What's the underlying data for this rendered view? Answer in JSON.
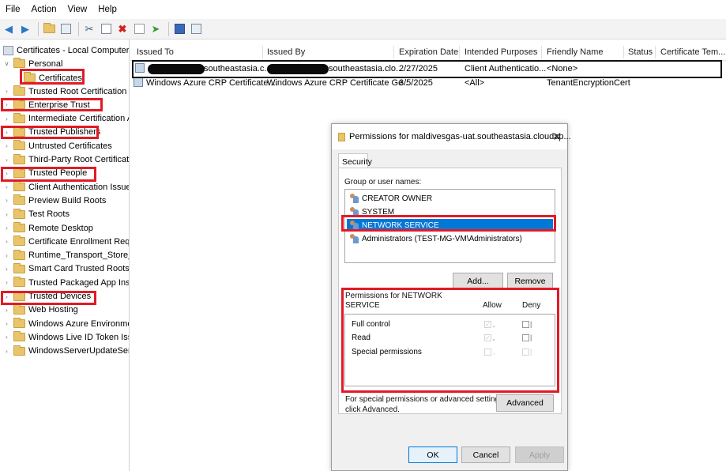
{
  "menu": [
    "File",
    "Action",
    "View",
    "Help"
  ],
  "toolbar_icons": [
    "back-arrow-icon",
    "forward-arrow-icon",
    "up-folder-icon",
    "show-hide-tree-icon",
    "cut-icon",
    "copy-icon",
    "delete-icon",
    "properties-icon",
    "export-icon",
    "help-icon",
    "mmc-view-icon"
  ],
  "tree": {
    "root": "Certificates - Local Computer",
    "personal": "Personal",
    "certificates": "Certificates",
    "items": [
      "Trusted Root Certification Aut",
      "Enterprise Trust",
      "Intermediate Certification Aut",
      "Trusted Publishers",
      "Untrusted Certificates",
      "Third-Party Root Certification",
      "Trusted People",
      "Client Authentication Issuers",
      "Preview Build Roots",
      "Test Roots",
      "Remote Desktop",
      "Certificate Enrollment Reques",
      "Runtime_Transport_Store_D2E",
      "Smart Card Trusted Roots",
      "Trusted Packaged App Installa",
      "Trusted Devices",
      "Web Hosting",
      "Windows Azure Environment",
      "Windows Live ID Token Issuer",
      "WindowsServerUpdateService"
    ]
  },
  "list": {
    "columns": [
      "Issued To",
      "Issued By",
      "Expiration Date",
      "Intended Purposes",
      "Friendly Name",
      "Status",
      "Certificate Tem..."
    ],
    "rows": [
      {
        "issued_to": "southeastasia.c...",
        "issued_by": ".southeastasia.clo...",
        "expiration": "2/27/2025",
        "purposes": "Client Authenticatio...",
        "friendly": "<None>"
      },
      {
        "issued_to": "Windows Azure CRP Certificate ...",
        "issued_by": "Windows Azure CRP Certificate Ge...",
        "expiration": "3/5/2025",
        "purposes": "<All>",
        "friendly": "TenantEncryptionCert"
      }
    ]
  },
  "dialog": {
    "title": "Permissions for maldivesgas-uat.southeastasia.cloudap...",
    "tab": "Security",
    "group_label": "Group or user names:",
    "users": [
      "CREATOR OWNER",
      "SYSTEM",
      "NETWORK SERVICE",
      "Administrators (TEST-MG-VM\\Administrators)"
    ],
    "selected_user": "NETWORK SERVICE",
    "add": "Add...",
    "remove": "Remove",
    "perm_title_1": "Permissions for NETWORK",
    "perm_title_2": "SERVICE",
    "allow": "Allow",
    "deny": "Deny",
    "permissions": [
      {
        "name": "Full control",
        "allow": true,
        "deny": false
      },
      {
        "name": "Read",
        "allow": true,
        "deny": false
      },
      {
        "name": "Special permissions",
        "allow": false,
        "deny": false
      }
    ],
    "special_note_1": "For special permissions or advanced settings,",
    "special_note_2": "click Advanced.",
    "advanced": "Advanced",
    "ok": "OK",
    "cancel": "Cancel",
    "apply": "Apply"
  },
  "colors": {
    "highlight": "#e21a26",
    "selection": "#0078d7"
  }
}
